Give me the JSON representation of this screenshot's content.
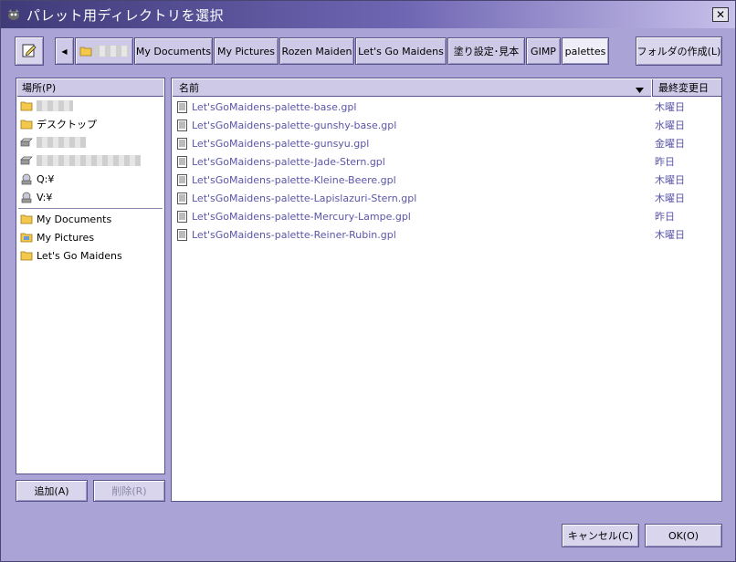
{
  "window": {
    "title": "パレット用ディレクトリを選択",
    "close_label": "✕"
  },
  "toolbar": {
    "edit_icon": "pencil-edit-icon",
    "back_label": "◀",
    "create_folder_label": "フォルダの作成(L)"
  },
  "breadcrumbs": [
    {
      "label": "",
      "type": "folder-blurred"
    },
    {
      "label": "My Documents"
    },
    {
      "label": "My Pictures"
    },
    {
      "label": "Rozen Maiden"
    },
    {
      "label": "Let's Go Maidens"
    },
    {
      "label": "塗り設定･見本"
    },
    {
      "label": "GIMP"
    },
    {
      "label": "palettes",
      "active": true
    }
  ],
  "places": {
    "header": "場所(P)",
    "items": [
      {
        "label": "",
        "icon": "folder-icon",
        "blurred": true
      },
      {
        "label": "デスクトップ",
        "icon": "folder-icon"
      },
      {
        "label": "",
        "icon": "drive-icon",
        "blurred": true
      },
      {
        "label": "",
        "icon": "drive-icon",
        "blurred": true
      },
      {
        "label": "Q:¥",
        "icon": "network-drive-icon"
      },
      {
        "label": "V:¥",
        "icon": "network-drive-icon"
      }
    ],
    "bookmarks": [
      {
        "label": "My Documents",
        "icon": "folder-icon"
      },
      {
        "label": "My Pictures",
        "icon": "pictures-folder-icon"
      },
      {
        "label": "Let's Go Maidens",
        "icon": "folder-icon"
      }
    ],
    "add_label": "追加(A)",
    "remove_label": "削除(R)"
  },
  "files": {
    "col_name": "名前",
    "col_modified": "最終変更日",
    "rows": [
      {
        "name": "Let'sGoMaidens-palette-base.gpl",
        "modified": "木曜日"
      },
      {
        "name": "Let'sGoMaidens-palette-gunshy-base.gpl",
        "modified": "水曜日"
      },
      {
        "name": "Let'sGoMaidens-palette-gunsyu.gpl",
        "modified": "金曜日"
      },
      {
        "name": "Let'sGoMaidens-palette-Jade-Stern.gpl",
        "modified": "昨日"
      },
      {
        "name": "Let'sGoMaidens-palette-Kleine-Beere.gpl",
        "modified": "木曜日"
      },
      {
        "name": "Let'sGoMaidens-palette-Lapislazuri-Stern.gpl",
        "modified": "木曜日"
      },
      {
        "name": "Let'sGoMaidens-palette-Mercury-Lampe.gpl",
        "modified": "昨日"
      },
      {
        "name": "Let'sGoMaidens-palette-Reiner-Rubin.gpl",
        "modified": "木曜日"
      }
    ]
  },
  "footer": {
    "cancel_label": "キャンセル(C)",
    "ok_label": "OK(O)"
  },
  "colors": {
    "window_bg": "#a9a3d6",
    "title_gradient_start": "#3f3a78",
    "link_text": "#5a55a8"
  }
}
